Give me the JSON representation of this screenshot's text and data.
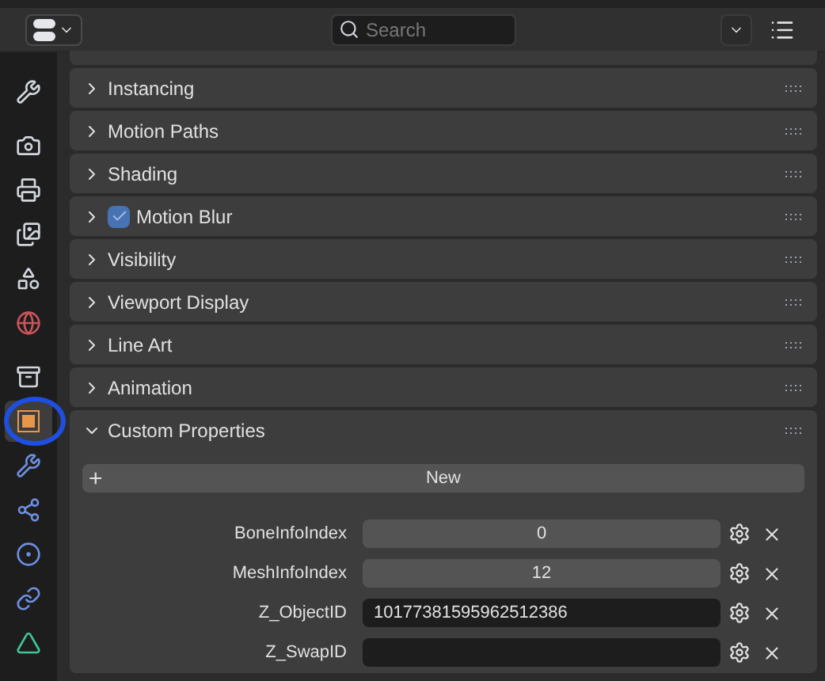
{
  "header": {
    "search": {
      "placeholder": "Search"
    }
  },
  "tabs": [
    {
      "kind": "tool",
      "selected": false
    },
    {
      "kind": "render",
      "selected": false
    },
    {
      "kind": "output",
      "selected": false
    },
    {
      "kind": "view-layer",
      "selected": false
    },
    {
      "kind": "scene",
      "selected": false
    },
    {
      "kind": "world",
      "selected": false
    },
    {
      "kind": "collection",
      "selected": false
    },
    {
      "kind": "object",
      "selected": true
    },
    {
      "kind": "modifier",
      "selected": false
    },
    {
      "kind": "particles",
      "selected": false
    },
    {
      "kind": "physics",
      "selected": false
    },
    {
      "kind": "constraints",
      "selected": false
    },
    {
      "kind": "data",
      "selected": false
    }
  ],
  "panels": [
    {
      "title": "Instancing",
      "expanded": false
    },
    {
      "title": "Motion Paths",
      "expanded": false
    },
    {
      "title": "Shading",
      "expanded": false
    },
    {
      "title": "Motion Blur",
      "expanded": false,
      "checked": true
    },
    {
      "title": "Visibility",
      "expanded": false
    },
    {
      "title": "Viewport Display",
      "expanded": false
    },
    {
      "title": "Line Art",
      "expanded": false
    },
    {
      "title": "Animation",
      "expanded": false
    },
    {
      "title": "Custom Properties",
      "expanded": true
    }
  ],
  "custom_properties": {
    "new_button": {
      "icon": "+",
      "label": "New"
    },
    "properties": [
      {
        "name": "BoneInfoIndex",
        "kind": "number",
        "value": "0"
      },
      {
        "name": "MeshInfoIndex",
        "kind": "number",
        "value": "12"
      },
      {
        "name": "Z_ObjectID",
        "kind": "text",
        "value": "10177381595962512386"
      },
      {
        "name": "Z_SwapID",
        "kind": "text"
      }
    ]
  }
}
